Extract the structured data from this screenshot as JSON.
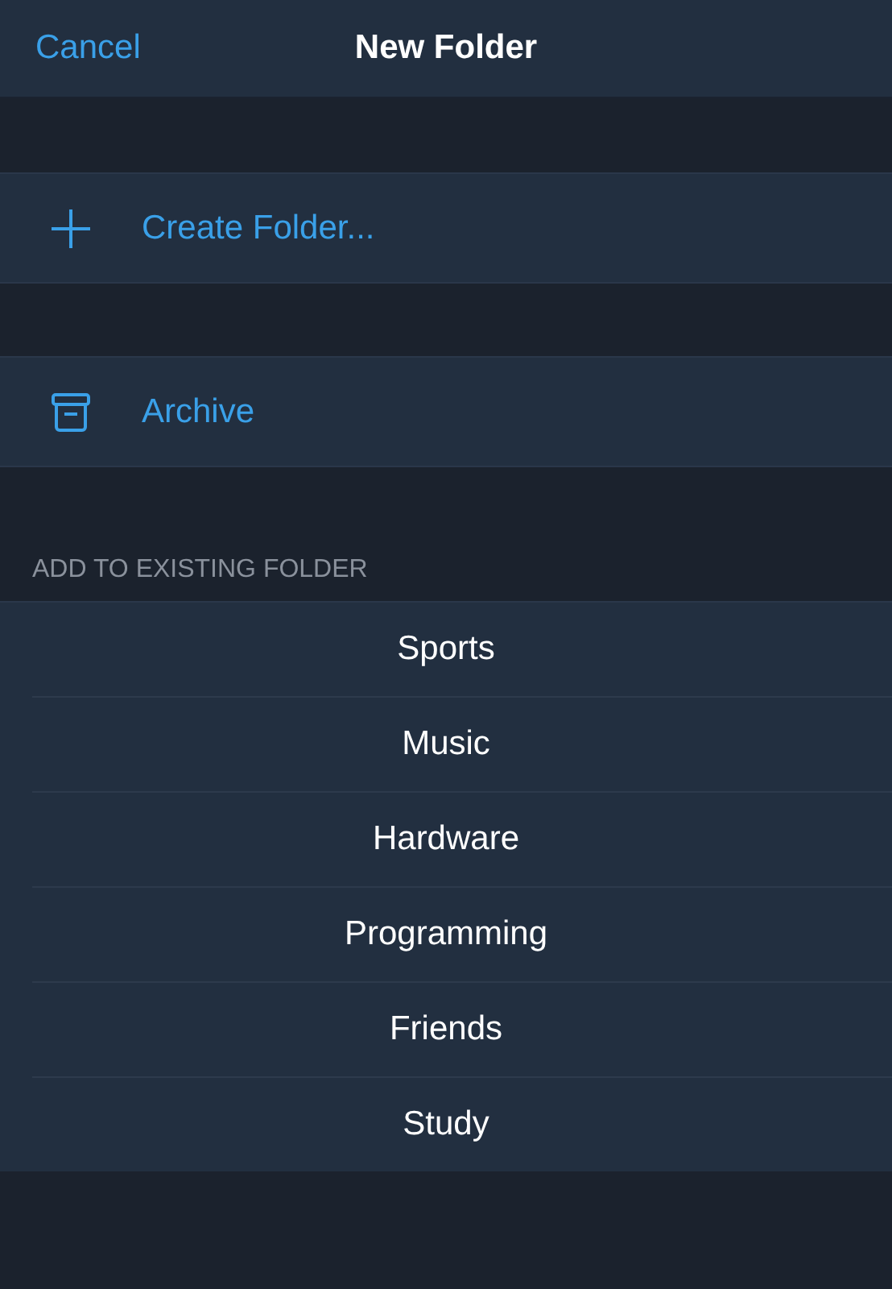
{
  "nav": {
    "cancel": "Cancel",
    "title": "New Folder"
  },
  "actions": [
    {
      "kind": "plus",
      "label": "Create Folder..."
    },
    {
      "kind": "archive",
      "label": "Archive"
    }
  ],
  "folders_header": "ADD TO EXISTING FOLDER",
  "folders": [
    "Sports",
    "Music",
    "Hardware",
    "Programming",
    "Friends",
    "Study"
  ]
}
